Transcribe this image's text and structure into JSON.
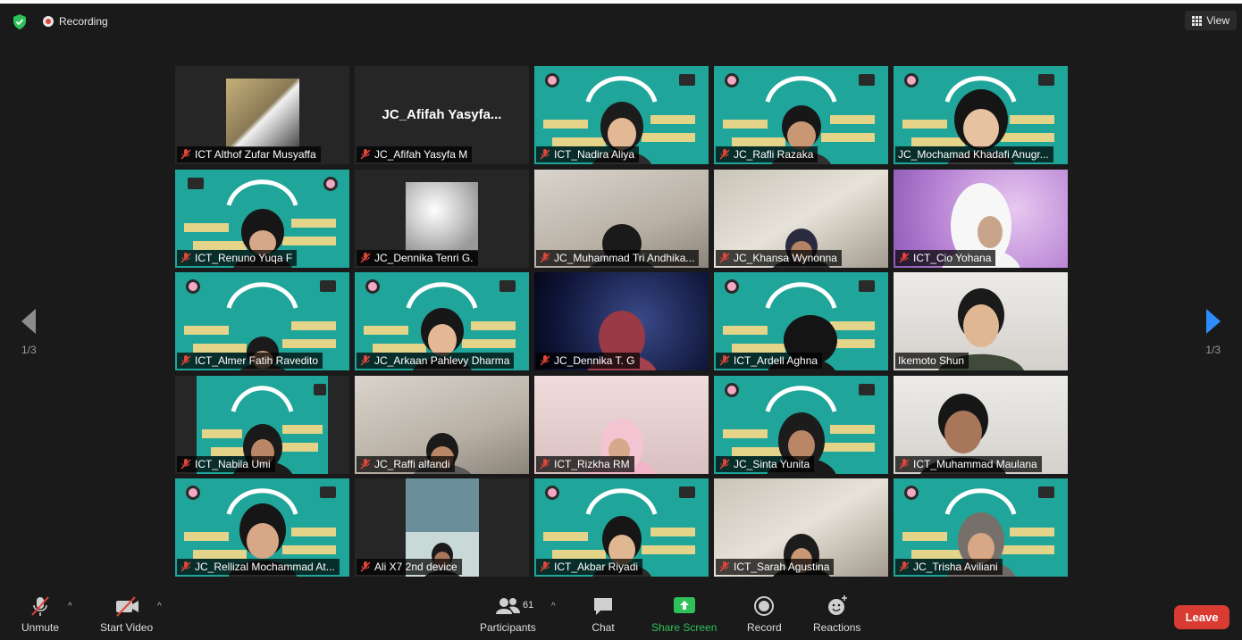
{
  "topbar": {
    "recording_label": "Recording",
    "view_label": "View"
  },
  "pagination": {
    "left": "1/3",
    "right": "1/3"
  },
  "big_name": "JC_Afifah  Yasyfa...",
  "participants": [
    {
      "name": "ICT Althof Zufar Musyaffa"
    },
    {
      "name": "JC_Afifah Yasyfa M"
    },
    {
      "name": "ICT_Nadira Aliya"
    },
    {
      "name": "JC_Rafli Razaka"
    },
    {
      "name": "JC_Mochamad Khadafi Anugr..."
    },
    {
      "name": "ICT_Renuno Yuqa F"
    },
    {
      "name": "JC_Dennika Tenri G."
    },
    {
      "name": "JC_Muhammad Tri Andhika..."
    },
    {
      "name": "JC_Khansa Wynonna"
    },
    {
      "name": "ICT_Cio Yohana"
    },
    {
      "name": "ICT_Almer Fatih Ravedito"
    },
    {
      "name": "JC_Arkaan Pahlevy Dharma"
    },
    {
      "name": "JC_Dennika T. G"
    },
    {
      "name": "ICT_Ardell Aghna"
    },
    {
      "name": "Ikemoto Shun"
    },
    {
      "name": "ICT_Nabila Umi"
    },
    {
      "name": "JC_Raffi alfandi"
    },
    {
      "name": "ICT_Rizkha RM"
    },
    {
      "name": "JC_Sinta Yunita"
    },
    {
      "name": "ICT_Muhammad Maulana"
    },
    {
      "name": "JC_Rellizal Mochammad At..."
    },
    {
      "name": "Ali X7 2nd device"
    },
    {
      "name": "ICT_Akbar Riyadi"
    },
    {
      "name": "ICT_Sarah Agustina"
    },
    {
      "name": "JC_Trisha Aviliani"
    }
  ],
  "toolbar": {
    "unmute": "Unmute",
    "start_video": "Start Video",
    "participants": "Participants",
    "participants_count": "61",
    "chat": "Chat",
    "share_screen": "Share Screen",
    "record": "Record",
    "reactions": "Reactions",
    "leave": "Leave"
  },
  "colors": {
    "leave": "#d93b33",
    "share": "#2ec15a",
    "nav_arrow_right": "#2d8cff",
    "muted_icon": "#e0453a",
    "tile_teal": "#1fa59a"
  }
}
